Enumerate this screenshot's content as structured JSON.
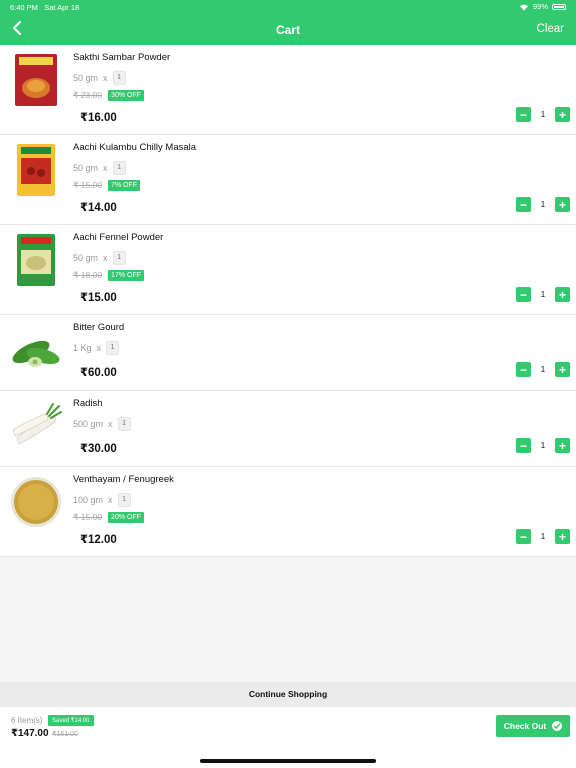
{
  "status": {
    "time": "6:40 PM",
    "date": "Sat Apr 18",
    "battery": "99%"
  },
  "header": {
    "title": "Cart",
    "clear_label": "Clear"
  },
  "items": [
    {
      "name": "Sakthi Sambar Powder",
      "qty_unit": "50 gm",
      "x": "x",
      "qty": "1",
      "mrp": "₹ 23.00",
      "off": "30% OFF",
      "price": "₹16.00",
      "count": "1"
    },
    {
      "name": "Aachi Kulambu Chilly Masala",
      "qty_unit": "50 gm",
      "x": "x",
      "qty": "1",
      "mrp": "₹ 15.00",
      "off": "7% OFF",
      "price": "₹14.00",
      "count": "1"
    },
    {
      "name": "Aachi Fennel Powder",
      "qty_unit": "50 gm",
      "x": "x",
      "qty": "1",
      "mrp": "₹ 18.00",
      "off": "17% OFF",
      "price": "₹15.00",
      "count": "1"
    },
    {
      "name": "Bitter Gourd",
      "qty_unit": "1 Kg",
      "x": "x",
      "qty": "1",
      "price": "₹60.00",
      "count": "1"
    },
    {
      "name": "Radish",
      "qty_unit": "500 gm",
      "x": "x",
      "qty": "1",
      "price": "₹30.00",
      "count": "1"
    },
    {
      "name": "Venthayam / Fenugreek",
      "qty_unit": "100 gm",
      "x": "x",
      "qty": "1",
      "mrp": "₹ 15.00",
      "off": "20% OFF",
      "price": "₹12.00",
      "count": "1"
    }
  ],
  "stepper": {
    "minus": "−",
    "plus": "+"
  },
  "continue_label": "Continue Shopping",
  "footer": {
    "items_count": "6 Item(s)",
    "saved": "Saved ₹14.00",
    "total": "₹147.00",
    "total_mrp": "₹161.00",
    "checkout_label": "Check Out"
  },
  "colors": {
    "accent": "#33c96f"
  }
}
